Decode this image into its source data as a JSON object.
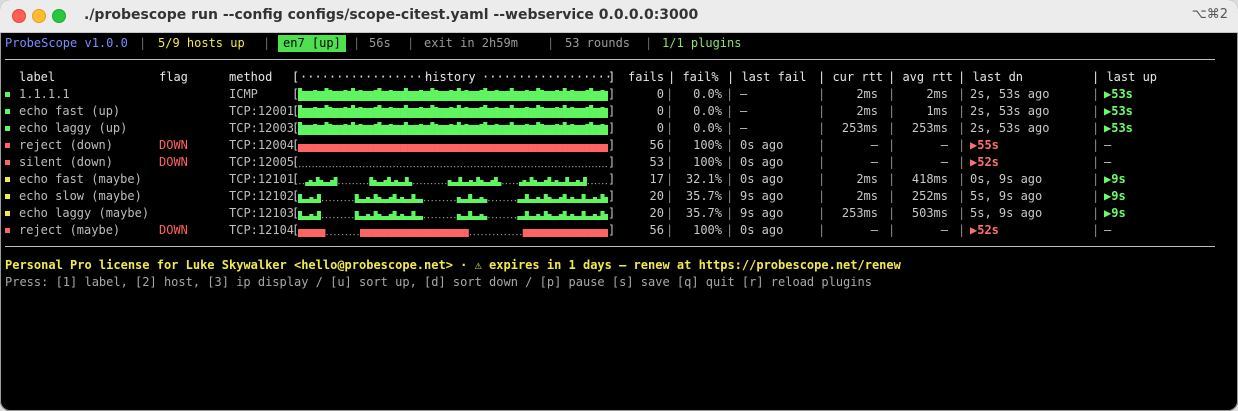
{
  "window": {
    "title": "./probescope run --config configs/scope-citest.yaml --webservice 0.0.0.0:3000",
    "shortcut": "⌥⌘2"
  },
  "status": {
    "app": "ProbeScope v1.0.0",
    "hosts_up": "5/9 hosts up",
    "env": "en7 [up]",
    "uptime": "56s",
    "exit_in": "exit in 2h59m",
    "rounds": "53 rounds",
    "plugins": "1/1 plugins",
    "separator": "|"
  },
  "colors": {
    "ok": "#5ff55f",
    "fail": "#ff6464",
    "warn": "#f2e94e",
    "accent": "#7b8cff"
  },
  "headers": {
    "label": "label",
    "flag": "flag",
    "method": "method",
    "history_open": "[",
    "history_dots_left": "··················",
    "history": "history",
    "history_dots_right": "··················",
    "history_close": "]",
    "fails": "fails",
    "failpct": "| fail%",
    "lastfail": "| last fail",
    "currtt": "| cur rtt",
    "avgrtt": "| avg rtt",
    "lastdn": "| last dn",
    "lastup": "| last up"
  },
  "rows": [
    {
      "label": "1.1.1.1",
      "flag": "",
      "method": "ICMP",
      "fails": "0",
      "failpct": "0.0%",
      "lastfail": "–",
      "currtt": "2ms",
      "avgrtt": "2ms",
      "lastdn": "2s, 53s ago",
      "lastup": "▶53s",
      "state": "up",
      "history": "gggggggggggggggggggggggggggggggggggggggggggggggggggggggggggggggggggggggggggggggggg"
    },
    {
      "label": "echo fast (up)",
      "flag": "",
      "method": "TCP:12001",
      "fails": "0",
      "failpct": "0.0%",
      "lastfail": "–",
      "currtt": "2ms",
      "avgrtt": "1ms",
      "lastdn": "2s, 53s ago",
      "lastup": "▶53s",
      "state": "up",
      "history": "gggggggggggggggggggggggggggggggggggggggggggggggggggggggggggggggggggggggggggggggggg"
    },
    {
      "label": "echo laggy (up)",
      "flag": "",
      "method": "TCP:12003",
      "fails": "0",
      "failpct": "0.0%",
      "lastfail": "–",
      "currtt": "253ms",
      "avgrtt": "253ms",
      "lastdn": "2s, 53s ago",
      "lastup": "▶53s",
      "state": "up",
      "history": "gggggggggggggggggggggggggggggggggggggggggggggggggggggggggggggggggggggggggggggggggg"
    },
    {
      "label": "reject (down)",
      "flag": "DOWN",
      "method": "TCP:12004",
      "fails": "56",
      "failpct": "100%",
      "lastfail": "0s ago",
      "currtt": "–",
      "avgrtt": "–",
      "lastdn": "▶55s",
      "lastup": "–",
      "state": "down",
      "history": "rrrrrrrrrrrrrrrrrrrrrrrrrrrrrrrrrrrrrrrrrrrrrrrrrrrrrrrrrrrrrrrrrrrrrrrrrrrrrrrrrr"
    },
    {
      "label": "silent (down)",
      "flag": "DOWN",
      "method": "TCP:12005",
      "fails": "53",
      "failpct": "100%",
      "lastfail": "0s ago",
      "currtt": "–",
      "avgrtt": "–",
      "lastdn": "▶52s",
      "lastup": "–",
      "state": "down",
      "history": "............................................................................................"
    },
    {
      "label": "echo fast (maybe)",
      "flag": "",
      "method": "TCP:12101",
      "fails": "17",
      "failpct": "32.1%",
      "lastfail": "0s ago",
      "currtt": "2ms",
      "avgrtt": "418ms",
      "lastdn": "0s, 9s ago",
      "lastup": "▶9s",
      "state": "maybe",
      "history": "..ggggggggg.........gggggggggggg..........ggggggggggggggg.....ggggggggggggggggggg......"
    },
    {
      "label": "echo slow (maybe)",
      "flag": "",
      "method": "TCP:12102",
      "fails": "20",
      "failpct": "35.7%",
      "lastfail": "9s ago",
      "currtt": "2ms",
      "avgrtt": "252ms",
      "lastdn": "5s, 9s ago",
      "lastup": "▶9s",
      "state": "maybe",
      "history": "gggggg.........gggggggggggggggggg.........gggggggg........gggggggggggggggggggggggg"
    },
    {
      "label": "echo laggy (maybe)",
      "flag": "",
      "method": "TCP:12103",
      "fails": "20",
      "failpct": "35.7%",
      "lastfail": "9s ago",
      "currtt": "253ms",
      "avgrtt": "503ms",
      "lastdn": "5s, 9s ago",
      "lastup": "▶9s",
      "state": "maybe",
      "history": "gggggg.........gggggggggggggggggg.........gggggggg........gggggggggggggggggggggggg"
    },
    {
      "label": "reject (maybe)",
      "flag": "DOWN",
      "method": "TCP:12104",
      "fails": "56",
      "failpct": "100%",
      "lastfail": "0s ago",
      "currtt": "–",
      "avgrtt": "–",
      "lastdn": "▶52s",
      "lastup": "–",
      "state": "down",
      "history": "rrrrrrr.........rrrrrrrrrrrrrrrrrrrrrrrrrrrr..............rrrrrrrrrrrrrrrrrrrrrr"
    }
  ],
  "row_sep": "|",
  "footer": {
    "license": "Personal Pro license for Luke Skywalker <hello@probescope.net>  ·  ⚠ expires in 1 days – renew at https://probescope.net/renew",
    "help": "Press: [1] label, [2] host, [3] ip display / [u] sort up, [d] sort down / [p] pause [s] save [q] quit [r] reload plugins"
  }
}
